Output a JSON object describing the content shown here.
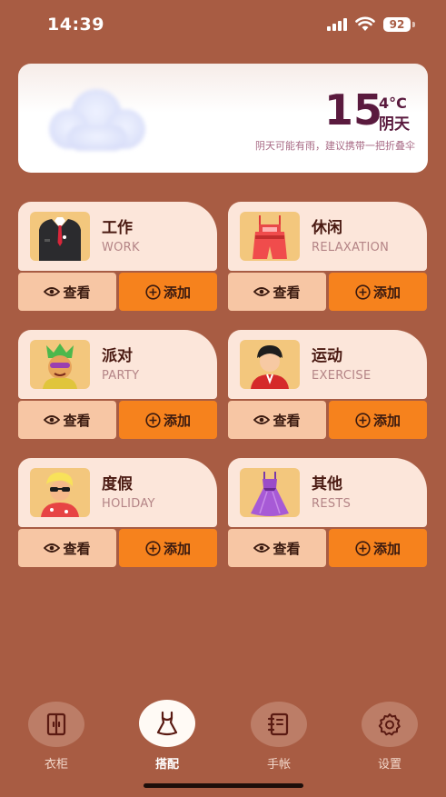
{
  "status": {
    "time": "14:39",
    "battery": "92"
  },
  "weather": {
    "temperature": "15",
    "unit": "4°C",
    "condition": "阴天",
    "tip": "阴天可能有雨，建议携带一把折叠伞"
  },
  "categories": [
    {
      "title": "工作",
      "subtitle": "WORK",
      "icon": "suit-icon",
      "view": "查看",
      "add": "添加"
    },
    {
      "title": "休闲",
      "subtitle": "RELAXATION",
      "icon": "overalls-icon",
      "view": "查看",
      "add": "添加"
    },
    {
      "title": "派对",
      "subtitle": "PARTY",
      "icon": "party-costume-icon",
      "view": "查看",
      "add": "添加"
    },
    {
      "title": "运动",
      "subtitle": "EXERCISE",
      "icon": "sportswear-icon",
      "view": "查看",
      "add": "添加"
    },
    {
      "title": "度假",
      "subtitle": "HOLIDAY",
      "icon": "vacation-outfit-icon",
      "view": "查看",
      "add": "添加"
    },
    {
      "title": "其他",
      "subtitle": "RESTS",
      "icon": "dress-icon",
      "view": "查看",
      "add": "添加"
    }
  ],
  "tabs": [
    {
      "label": "衣柜",
      "icon": "wardrobe-icon"
    },
    {
      "label": "搭配",
      "icon": "outfit-icon",
      "active": true
    },
    {
      "label": "手帐",
      "icon": "notebook-icon"
    },
    {
      "label": "设置",
      "icon": "gear-icon"
    }
  ],
  "colors": {
    "background": "#a85c43",
    "card": "#fce6da",
    "view_button": "#f7c6a4",
    "add_button": "#f6821d",
    "accent_text": "#5a1a3e"
  }
}
